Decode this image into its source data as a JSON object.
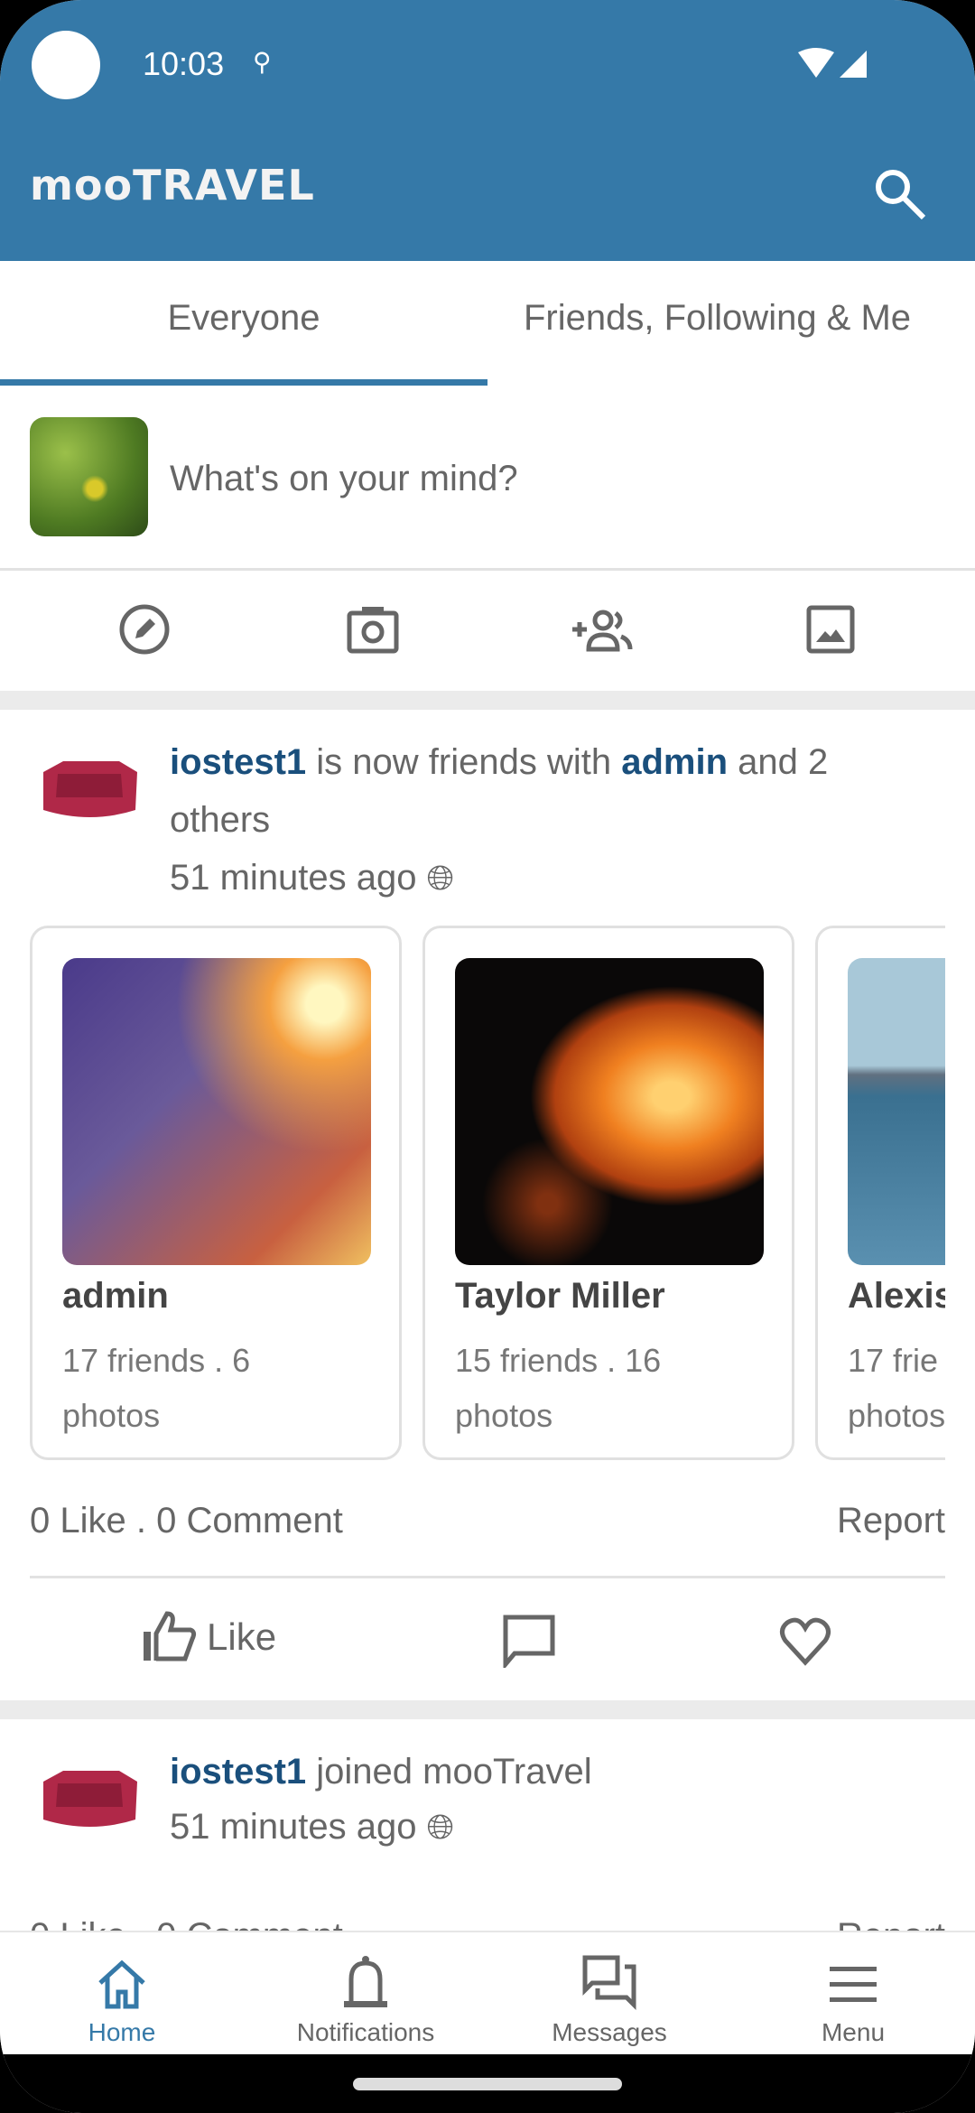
{
  "status_bar": {
    "time": "10:03"
  },
  "header": {
    "logo": "mooTRAVEL",
    "search_icon": "search-icon"
  },
  "tabs": [
    {
      "label": "Everyone",
      "active": true
    },
    {
      "label": "Friends, Following & Me",
      "active": false
    }
  ],
  "composer": {
    "placeholder": "What's on your mind?",
    "actions": [
      "edit-icon",
      "camera-icon",
      "add-friends-icon",
      "image-icon"
    ]
  },
  "posts": [
    {
      "user": "iostest1",
      "text_before": " is now friends with ",
      "target": "admin",
      "text_after": " and 2 others",
      "time": "51 minutes ago",
      "friends": [
        {
          "name": "admin",
          "friends": "17 friends . 6",
          "photos": "photos"
        },
        {
          "name": "Taylor Miller",
          "friends": "15 friends . 16",
          "photos": "photos"
        },
        {
          "name": "Alexis",
          "friends": "17 frie",
          "photos": "photos"
        }
      ],
      "stats": "0 Like . 0 Comment",
      "report": "Report",
      "like_label": "Like"
    },
    {
      "user": "iostest1",
      "text": " joined mooTravel",
      "time": "51 minutes ago"
    }
  ],
  "bottom_nav": [
    {
      "label": "Home",
      "active": true
    },
    {
      "label": "Notifications"
    },
    {
      "label": "Messages"
    },
    {
      "label": "Menu"
    }
  ],
  "colors": {
    "brand": "#3579a8",
    "link": "#1a4f7c"
  }
}
